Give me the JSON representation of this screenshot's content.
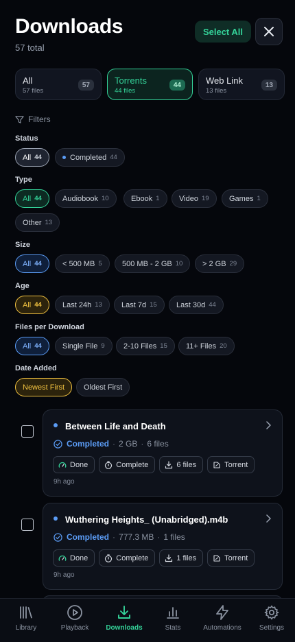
{
  "header": {
    "title": "Downloads",
    "subtitle": "57 total",
    "select_all": "Select All"
  },
  "tabs": [
    {
      "label": "All",
      "sub": "57 files",
      "count": "57",
      "active": false
    },
    {
      "label": "Torrents",
      "sub": "44 files",
      "count": "44",
      "active": true
    },
    {
      "label": "Web Link",
      "sub": "13 files",
      "count": "13",
      "active": false
    }
  ],
  "filters_label": "Filters",
  "sections": {
    "status": {
      "label": "Status",
      "chips": [
        {
          "label": "All",
          "count": "44"
        },
        {
          "label": "Completed",
          "count": "44"
        }
      ]
    },
    "type": {
      "label": "Type",
      "chips": [
        {
          "label": "All",
          "count": "44"
        },
        {
          "label": "Audiobook",
          "count": "10"
        },
        {
          "label": "Ebook",
          "count": "1"
        },
        {
          "label": "Video",
          "count": "19"
        },
        {
          "label": "Games",
          "count": "1"
        },
        {
          "label": "Other",
          "count": "13"
        }
      ]
    },
    "size": {
      "label": "Size",
      "chips": [
        {
          "label": "All",
          "count": "44"
        },
        {
          "label": "< 500 MB",
          "count": "5"
        },
        {
          "label": "500 MB - 2 GB",
          "count": "10"
        },
        {
          "label": "> 2 GB",
          "count": "29"
        }
      ]
    },
    "age": {
      "label": "Age",
      "chips": [
        {
          "label": "All",
          "count": "44"
        },
        {
          "label": "Last 24h",
          "count": "13"
        },
        {
          "label": "Last 7d",
          "count": "15"
        },
        {
          "label": "Last 30d",
          "count": "44"
        }
      ]
    },
    "files": {
      "label": "Files per Download",
      "chips": [
        {
          "label": "All",
          "count": "44"
        },
        {
          "label": "Single File",
          "count": "9"
        },
        {
          "label": "2-10 Files",
          "count": "15"
        },
        {
          "label": "11+ Files",
          "count": "20"
        }
      ]
    },
    "date": {
      "label": "Date Added",
      "chips": [
        {
          "label": "Newest First"
        },
        {
          "label": "Oldest First"
        }
      ]
    }
  },
  "downloads": [
    {
      "title": "Between Life and Death",
      "status": "Completed",
      "size": "2 GB",
      "files": "6 files",
      "pills": [
        "Done",
        "Complete",
        "6 files",
        "Torrent"
      ],
      "ago": "9h ago"
    },
    {
      "title": "Wuthering Heights_ (Unabridged).m4b",
      "status": "Completed",
      "size": "777.3 MB",
      "files": "1 files",
      "pills": [
        "Done",
        "Complete",
        "1 files",
        "Torrent"
      ],
      "ago": "9h ago"
    }
  ],
  "nav": [
    {
      "label": "Library",
      "icon": "library-icon"
    },
    {
      "label": "Playback",
      "icon": "play-circle-icon"
    },
    {
      "label": "Downloads",
      "icon": "download-icon",
      "active": true
    },
    {
      "label": "Stats",
      "icon": "bar-chart-icon"
    },
    {
      "label": "Automations",
      "icon": "lightning-icon"
    },
    {
      "label": "Settings",
      "icon": "gear-icon"
    }
  ],
  "colors": {
    "accent_green": "#34d399",
    "accent_blue": "#5b9cf5",
    "accent_yellow": "#f3c341",
    "background": "#05070c"
  }
}
